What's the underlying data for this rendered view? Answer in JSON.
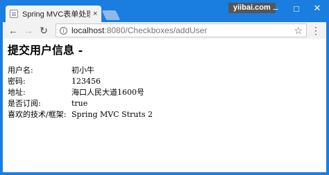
{
  "browser": {
    "tab_title": "Spring MVC表单处理（",
    "tab_close": "×",
    "brand": "yiibai.com",
    "url_host": "localhost",
    "url_path": ":8080/Checkboxes/addUser",
    "icons": [
      "back-icon",
      "forward-icon",
      "reload-icon",
      "info-icon",
      "star-icon",
      "menu-icon"
    ]
  },
  "page": {
    "title": "提交用户信息 -",
    "rows": [
      {
        "label": "用户名:",
        "value": "初小牛"
      },
      {
        "label": "密码:",
        "value": "123456"
      },
      {
        "label": "地址:",
        "value": "海口人民大道1600号"
      },
      {
        "label": "是否订阅:",
        "value": "true"
      },
      {
        "label": "喜欢的技术/框架:",
        "value": "Spring MVC Struts 2"
      }
    ]
  }
}
